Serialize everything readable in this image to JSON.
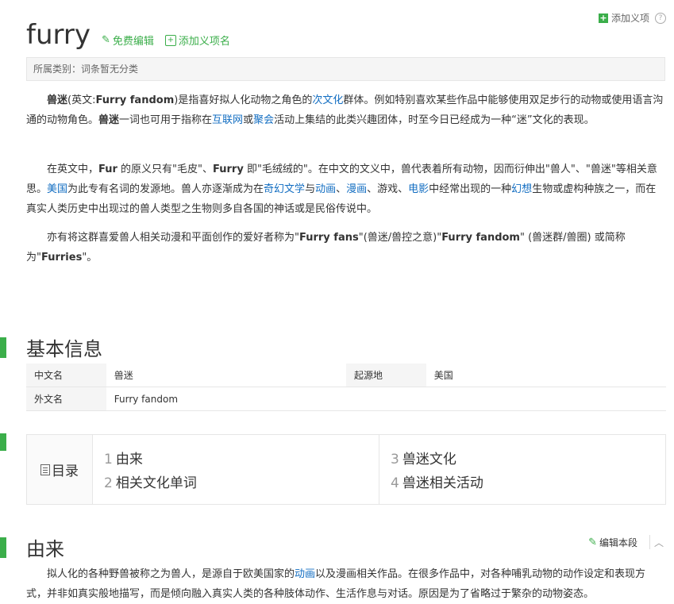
{
  "header": {
    "add_meaning_top": "添加义项",
    "help": "?",
    "title": "furry",
    "edit_label": "免费编辑",
    "add_meaning_label": "添加义项名"
  },
  "category": {
    "label": "所属类别：",
    "value": "词条暂无分类"
  },
  "para1": {
    "t1": "兽迷",
    "t2": "(英文:",
    "t3": "Furry fandom",
    "t4": ")是指喜好拟人化动物之角色的",
    "l1": "次文化",
    "t5": "群体。例如特别喜欢某些作品中能够使用双足步行的动物或使用语言沟通的动物角色。",
    "t6": "兽迷",
    "t7": "一词也可用于指称在",
    "l2": "互联网",
    "t8": "或",
    "l3": "聚会",
    "t9": "活动上集结的此类兴趣团体，时至今日已经成为一种“迷”文化的表现。"
  },
  "para2": {
    "t1": "在英文中，",
    "t2": "Fur",
    "t3": " 的原义只有\"毛皮\"、",
    "t4": "Furry",
    "t5": " 即\"毛绒绒的\"。在中文的文义中，兽代表着所有动物，因而衍伸出\"兽人\"、\"兽迷\"等相关意思。",
    "l1": "美国",
    "t6": "为此专有名词的发源地。兽人亦逐渐成为在",
    "l2": "奇幻文学",
    "t7": "与",
    "l3": "动画",
    "t8": "、",
    "l4": "漫画",
    "t9": "、游戏、",
    "l5": "电影",
    "t10": "中经常出现的一种",
    "l6": "幻想",
    "t11": "生物或虚构种族之一，而在真实人类历史中出现过的兽人类型之生物则多自各国的神话或是民俗传说中。"
  },
  "para3": {
    "t1": "亦有将这群喜爱兽人相关动漫和平面创作的爱好者称为\"",
    "t2": "Furry fans",
    "t3": "\"(兽迷/兽控之意)\"",
    "t4": "Furry fandom",
    "t5": "\" (兽迷群/兽圈) 或简称为\"",
    "t6": "Furries",
    "t7": "\"。"
  },
  "basic_info": {
    "title": "基本信息",
    "rows": [
      {
        "k1": "中文名",
        "v1": "兽迷",
        "k2": "起源地",
        "v2": "美国"
      },
      {
        "k1": "外文名",
        "v1": "Furry fandom",
        "k2": "",
        "v2": ""
      }
    ]
  },
  "toc": {
    "title": "目录",
    "items": [
      {
        "num": "1",
        "label": "由来"
      },
      {
        "num": "2",
        "label": "相关文化单词"
      },
      {
        "num": "3",
        "label": "兽迷文化"
      },
      {
        "num": "4",
        "label": "兽迷相关活动"
      }
    ]
  },
  "origin": {
    "title": "由来",
    "edit_label": "编辑本段",
    "t1": "拟人化的各种野兽被称之为兽人，是源自于欧美国家的",
    "l1": "动画",
    "t2": "以及漫画相关作品。在很多作品中，对各种哺乳动物的动作设定和表现方式，并非如真实般地描写，而是倾向融入真实人类的各种肢体动作、生活作息与对话。原因是为了省略过于繁杂的动物姿态。"
  },
  "colors": {
    "accent": "#3bae4a",
    "link": "#136ec2"
  }
}
